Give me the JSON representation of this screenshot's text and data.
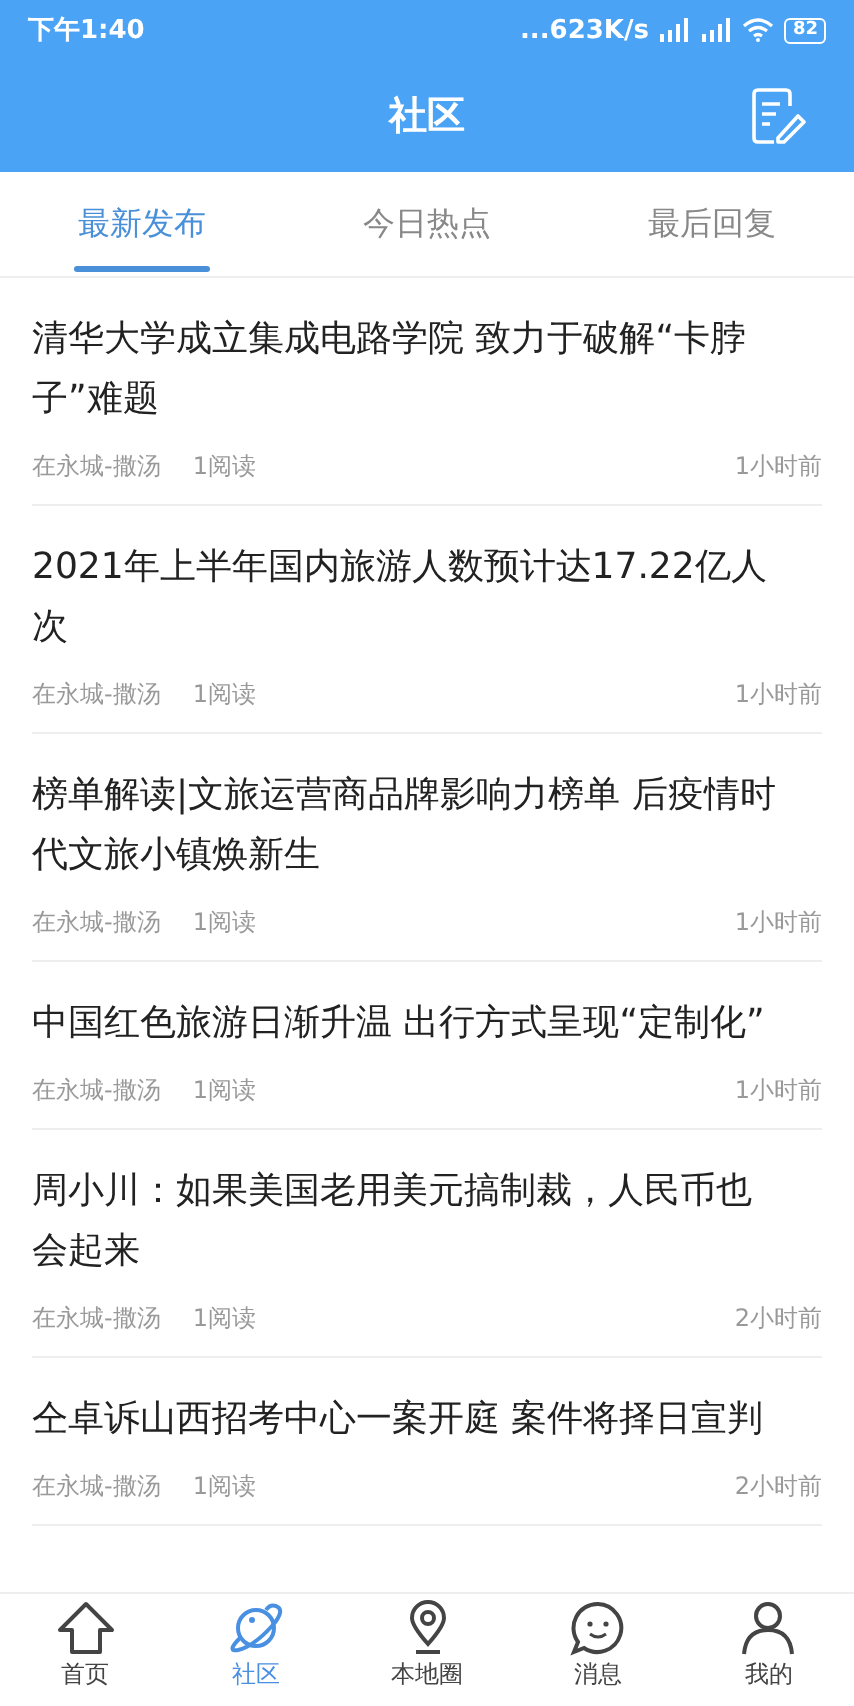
{
  "status_bar": {
    "time": "下午1:40",
    "network_speed": "...623K/s",
    "battery": "82"
  },
  "header": {
    "title": "社区"
  },
  "tabs": [
    {
      "label": "最新发布",
      "selected": true
    },
    {
      "label": "今日热点",
      "selected": false
    },
    {
      "label": "最后回复",
      "selected": false
    }
  ],
  "posts": [
    {
      "title": "清华大学成立集成电路学院 致力于破解“卡脖子”难题",
      "author": "在永城-撒汤",
      "reads": "1阅读",
      "time": "1小时前"
    },
    {
      "title": "2021年上半年国内旅游人数预计达17.22亿人次",
      "author": "在永城-撒汤",
      "reads": "1阅读",
      "time": "1小时前"
    },
    {
      "title": "榜单解读|文旅运营商品牌影响力榜单 后疫情时代文旅小镇焕新生",
      "author": "在永城-撒汤",
      "reads": "1阅读",
      "time": "1小时前"
    },
    {
      "title": "中国红色旅游日渐升温 出行方式呈现“定制化”",
      "author": "在永城-撒汤",
      "reads": "1阅读",
      "time": "1小时前"
    },
    {
      "title": "周小川：如果美国老用美元搞制裁，人民币也会起来",
      "author": "在永城-撒汤",
      "reads": "1阅读",
      "time": "2小时前"
    },
    {
      "title": "仝卓诉山西招考中心一案开庭 案件将择日宣判",
      "author": "在永城-撒汤",
      "reads": "1阅读",
      "time": "2小时前"
    }
  ],
  "nav": [
    {
      "label": "首页",
      "kind": "home",
      "selected": false
    },
    {
      "label": "社区",
      "kind": "planet",
      "selected": true
    },
    {
      "label": "本地圈",
      "kind": "pin",
      "selected": false
    },
    {
      "label": "消息",
      "kind": "chat",
      "selected": false
    },
    {
      "label": "我的",
      "kind": "person",
      "selected": false
    }
  ]
}
